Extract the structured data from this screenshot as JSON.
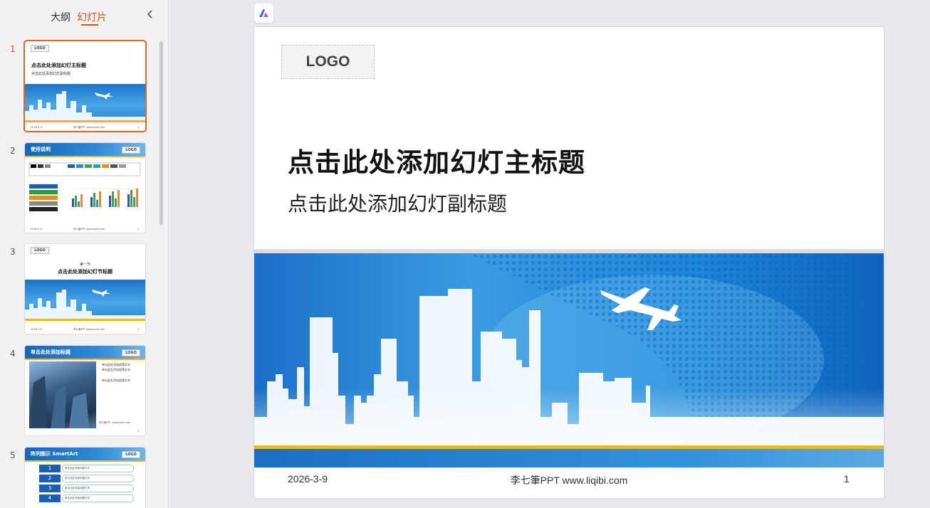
{
  "sidebar": {
    "tabs": [
      {
        "label": "大纲"
      },
      {
        "label": "幻灯片"
      }
    ],
    "collapse_icon": "chevron-left-icon",
    "thumbnails": [
      {
        "number": "1",
        "logo": "LOGO",
        "title": "点击此处添加幻灯主标题",
        "subtitle": "点击此处添加幻灯副标题",
        "footer_left": "2026-3-9",
        "footer_center": "李七筆PPT www.liqibi.com",
        "footer_right": "1"
      },
      {
        "number": "2",
        "header": "使用说明",
        "logo": "LOGO",
        "footer_left": "2026-3-9",
        "footer_center": "李七筆PPT www.liqibi.com",
        "footer_right": "2"
      },
      {
        "number": "3",
        "logo": "LOGO",
        "kicker": "第一节",
        "title": "点击此处添加幻灯节标题",
        "footer_left": "2026-3-9",
        "footer_center": "李七筆PPT www.liqibi.com",
        "footer_right": "3"
      },
      {
        "number": "4",
        "header": "单击此处添加标题",
        "logo": "LOGO",
        "lines": [
          "单击此处添加段落文本",
          "单击此处添加段落文本",
          "单击此处添加段落文本"
        ],
        "footer_center": "李七筆PPT www.liqibi.com",
        "footer_right": "4"
      },
      {
        "number": "5",
        "header": "阵列图示 SmartArt",
        "logo": "LOGO",
        "items": [
          "1",
          "2",
          "3",
          "4"
        ],
        "item_text": "单击此处添加标题文本"
      }
    ]
  },
  "slide": {
    "logo": "LOGO",
    "title": "点击此处添加幻灯主标题",
    "subtitle": "点击此处添加幻灯副标题",
    "footer_date": "2026-3-9",
    "footer_center": "李七筆PPT www.liqibi.com",
    "footer_number": "1"
  },
  "colors": {
    "accent": "#c55a1a",
    "banner_blue": "#1a73c8",
    "gold": "#f0b429"
  }
}
